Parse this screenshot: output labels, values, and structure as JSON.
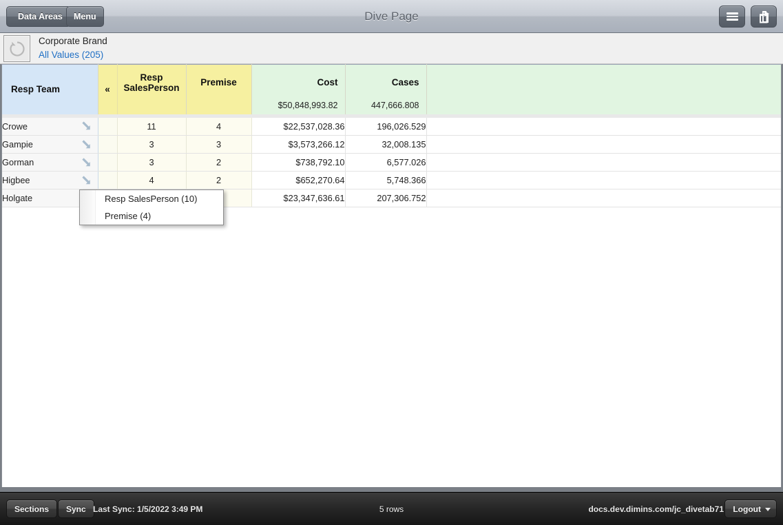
{
  "window": {
    "title": "Dive Page"
  },
  "toolbar": {
    "back_label": "Data Areas",
    "menu_label": "Menu",
    "hamburger_icon": "hamburger-icon",
    "share_icon": "share-icon"
  },
  "infobar": {
    "refresh_icon": "refresh-circle-icon",
    "title": "Corporate Brand",
    "subtitle": "All Values (205)"
  },
  "grid": {
    "collapse_glyph": "«",
    "columns": [
      {
        "label": "Resp Team",
        "total": "",
        "kind": "dimension"
      },
      {
        "label": "",
        "total": "",
        "kind": "collapse"
      },
      {
        "label": "Resp SalesPerson",
        "total": "",
        "kind": "count"
      },
      {
        "label": "Premise",
        "total": "",
        "kind": "count"
      },
      {
        "label": "Cost",
        "total": "$50,848,993.82",
        "kind": "measure"
      },
      {
        "label": "Cases",
        "total": "447,666.808",
        "kind": "measure"
      },
      {
        "label": "",
        "total": "",
        "kind": "filler"
      }
    ],
    "rows": [
      {
        "team": "Crowe",
        "salesperson": "11",
        "premise": "4",
        "cost": "$22,537,028.36",
        "cases": "196,026.529"
      },
      {
        "team": "Gampie",
        "salesperson": "3",
        "premise": "3",
        "cost": "$3,573,266.12",
        "cases": "32,008.135"
      },
      {
        "team": "Gorman",
        "salesperson": "3",
        "premise": "2",
        "cost": "$738,792.10",
        "cases": "6,577.026"
      },
      {
        "team": "Higbee",
        "salesperson": "4",
        "premise": "2",
        "cost": "$652,270.64",
        "cases": "5,748.366"
      },
      {
        "team": "Holgate",
        "salesperson": "",
        "premise": "",
        "cost": "$23,347,636.61",
        "cases": "207,306.752"
      }
    ],
    "drill_icon": "drill-down-arrow-icon"
  },
  "popup": {
    "items": [
      {
        "label": "Resp SalesPerson (10)"
      },
      {
        "label": "Premise (4)"
      }
    ]
  },
  "statusbar": {
    "sections_label": "Sections",
    "sync_label": "Sync",
    "last_sync": "Last Sync: 1/5/2022 3:49 PM",
    "rows_count": "5 rows",
    "host": "docs.dev.dimins.com/jc_divetab71",
    "logout_label": "Logout",
    "logout_caret_icon": "caret-down-icon"
  },
  "colors": {
    "dimension_header": "#d5e6f7",
    "count_header": "#f6f0a0",
    "measure_header": "#e1f5e1",
    "link": "#1f6fc4",
    "chrome": "#b4bac3"
  }
}
